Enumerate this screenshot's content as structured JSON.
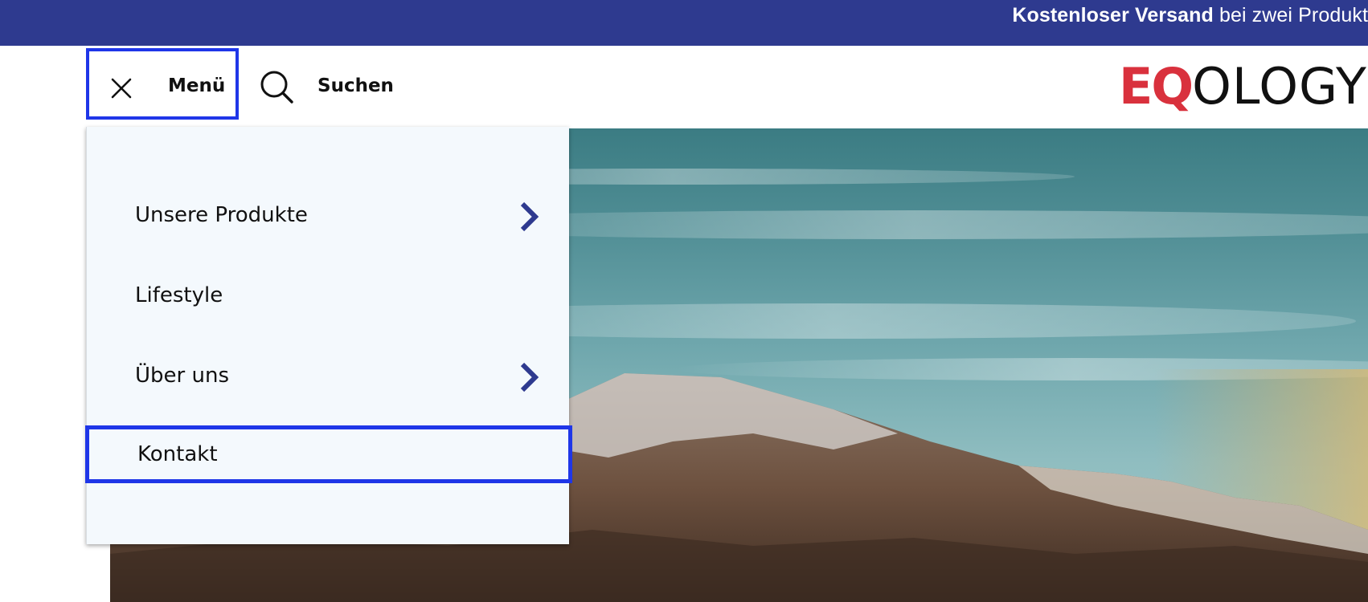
{
  "promo": {
    "bold": "Kostenloser Versand",
    "rest": " bei zwei Produkt"
  },
  "header": {
    "menu_label": "Menü",
    "search_label": "Suchen",
    "logo": {
      "part1": "EQ",
      "part2": "OLOGY"
    }
  },
  "menu": {
    "items": [
      {
        "label": "Unsere Produkte",
        "has_submenu": true
      },
      {
        "label": "Lifestyle",
        "has_submenu": false
      },
      {
        "label": "Über uns",
        "has_submenu": true
      },
      {
        "label": "Kontakt",
        "has_submenu": false
      }
    ]
  },
  "colors": {
    "brand_blue": "#2e3a8f",
    "focus_outline": "#1f36e8",
    "logo_red": "#d9313d",
    "menu_bg": "#f4f9fd"
  }
}
